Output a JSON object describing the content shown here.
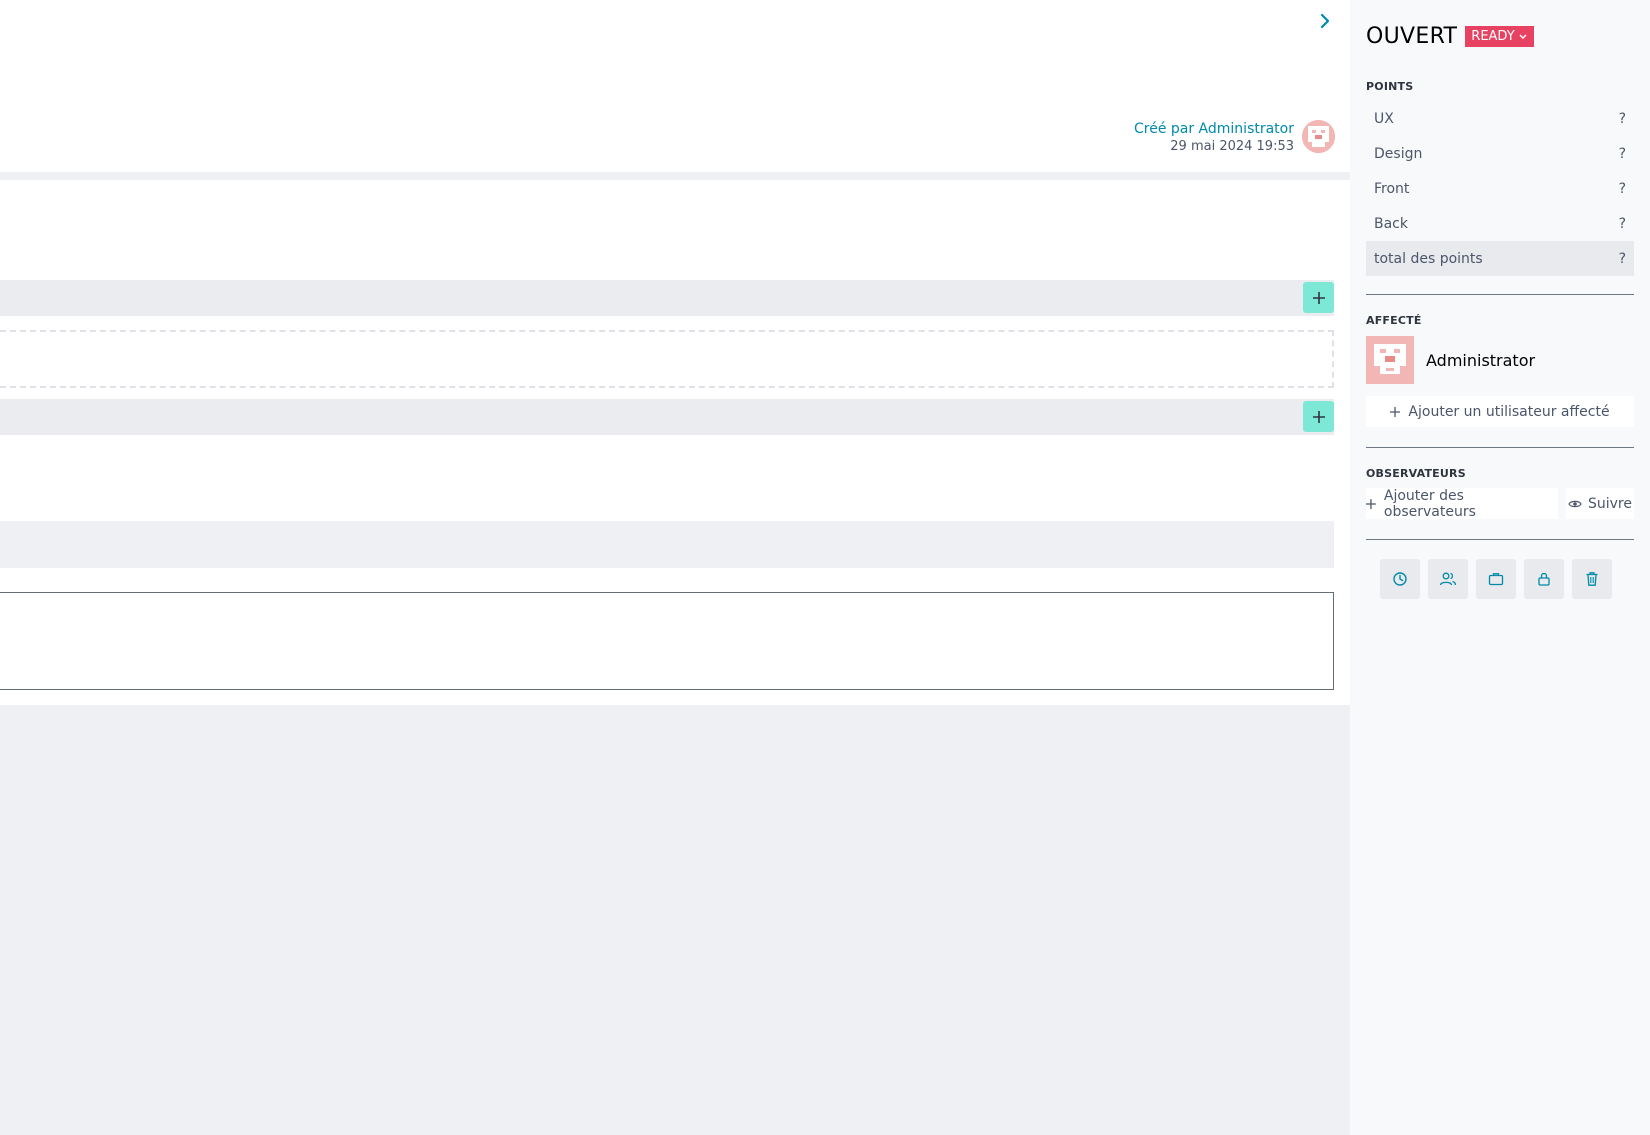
{
  "header": {
    "created_by": "Créé par Administrator",
    "created_date": "29 mai 2024 19:53"
  },
  "sidebar": {
    "status_title": "OUVERT",
    "status_badge": "READY",
    "points_label": "POINTS",
    "points": [
      {
        "name": "UX",
        "value": "?"
      },
      {
        "name": "Design",
        "value": "?"
      },
      {
        "name": "Front",
        "value": "?"
      },
      {
        "name": "Back",
        "value": "?"
      },
      {
        "name": "total des points",
        "value": "?"
      }
    ],
    "assigned_label": "AFFECTÉ",
    "assignee_name": "Administrator",
    "add_assignee_label": "Ajouter un utilisateur affecté",
    "watchers_label": "OBSERVATEURS",
    "add_watchers_label": "Ajouter des observateurs",
    "follow_label": "Suivre"
  },
  "colors": {
    "accent": "#008aa8",
    "status_badge": "#e84262",
    "add_button": "#7ee8d6",
    "avatar": "#f2b7b5"
  },
  "icons": {
    "collapse": "chevron-right-icon",
    "add": "plus-icon",
    "actions": [
      "clock-icon",
      "users-icon",
      "briefcase-icon",
      "lock-icon",
      "trash-icon"
    ]
  }
}
